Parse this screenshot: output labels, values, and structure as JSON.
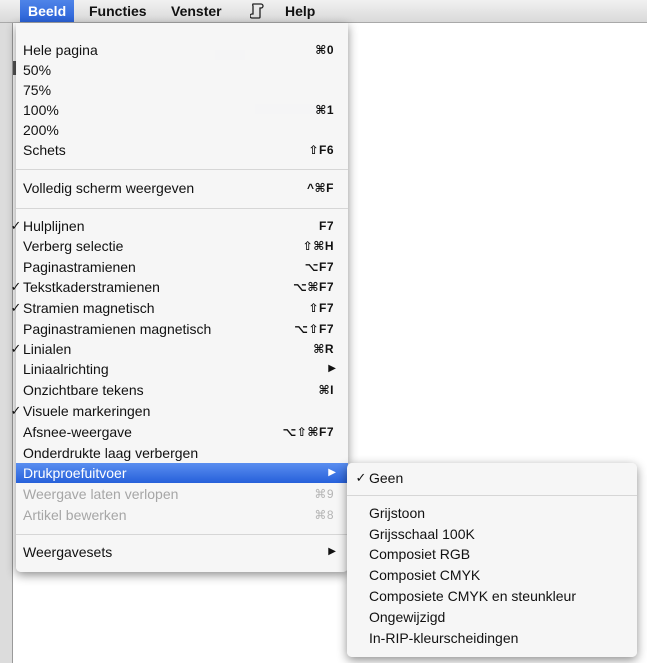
{
  "menubar": {
    "items": [
      "Beeld",
      "Functies",
      "Venster",
      "Help"
    ],
    "script_icon": "script-icon"
  },
  "beeld_menu": {
    "items": [
      {
        "label": "Hele pagina",
        "shortcut": "⌘0",
        "checked": false
      },
      {
        "label": "50%",
        "shortcut": "",
        "checked": false
      },
      {
        "label": "75%",
        "shortcut": "",
        "checked": false
      },
      {
        "label": "100%",
        "shortcut": "⌘1",
        "checked": false
      },
      {
        "label": "200%",
        "shortcut": "",
        "checked": false
      },
      {
        "label": "Schets",
        "shortcut": "⇧F6",
        "checked": false
      },
      {
        "label": "Volledig scherm weergeven",
        "shortcut": "^⌘F",
        "checked": false
      },
      {
        "label": "Hulplijnen",
        "shortcut": "F7",
        "checked": true
      },
      {
        "label": "Verberg selectie",
        "shortcut": "⇧⌘H",
        "checked": false
      },
      {
        "label": "Paginastramienen",
        "shortcut": "⌥F7",
        "checked": false
      },
      {
        "label": "Tekstkaderstramienen",
        "shortcut": "⌥⌘F7",
        "checked": true
      },
      {
        "label": "Stramien magnetisch",
        "shortcut": "⇧F7",
        "checked": true
      },
      {
        "label": "Paginastramienen magnetisch",
        "shortcut": "⌥⇧F7",
        "checked": false
      },
      {
        "label": "Linialen",
        "shortcut": "⌘R",
        "checked": true
      },
      {
        "label": "Liniaalrichting",
        "shortcut": "",
        "checked": false,
        "submenu": true
      },
      {
        "label": "Onzichtbare tekens",
        "shortcut": "⌘I",
        "checked": false
      },
      {
        "label": "Visuele markeringen",
        "shortcut": "",
        "checked": true
      },
      {
        "label": "Afsnee-weergave",
        "shortcut": "⌥⇧⌘F7",
        "checked": false
      },
      {
        "label": "Onderdrukte laag verbergen",
        "shortcut": "",
        "checked": false
      },
      {
        "label": "Drukproefuitvoer",
        "shortcut": "",
        "checked": false,
        "submenu": true,
        "highlighted": true
      },
      {
        "label": "Weergave laten verlopen",
        "shortcut": "⌘9",
        "checked": false,
        "disabled": true
      },
      {
        "label": "Artikel bewerken",
        "shortcut": "⌘8",
        "checked": false,
        "disabled": true
      },
      {
        "label": "Weergavesets",
        "shortcut": "",
        "checked": false,
        "submenu": true
      }
    ]
  },
  "drukproef_submenu": {
    "items": [
      {
        "label": "Geen",
        "checked": true
      },
      {
        "label": "Grijstoon",
        "checked": false
      },
      {
        "label": "Grijsschaal 100K",
        "checked": false
      },
      {
        "label": "Composiet RGB",
        "checked": false
      },
      {
        "label": "Composiet CMYK",
        "checked": false
      },
      {
        "label": "Composiete CMYK en steunkleur",
        "checked": false
      },
      {
        "label": "Ongewijzigd",
        "checked": false
      },
      {
        "label": "In-RIP-kleurscheidingen",
        "checked": false
      }
    ]
  },
  "symbols": {
    "check": "✓",
    "arrow": "▶"
  },
  "colors": {
    "highlight": "#2a62d8",
    "disabled_text": "#a6a6a6"
  }
}
